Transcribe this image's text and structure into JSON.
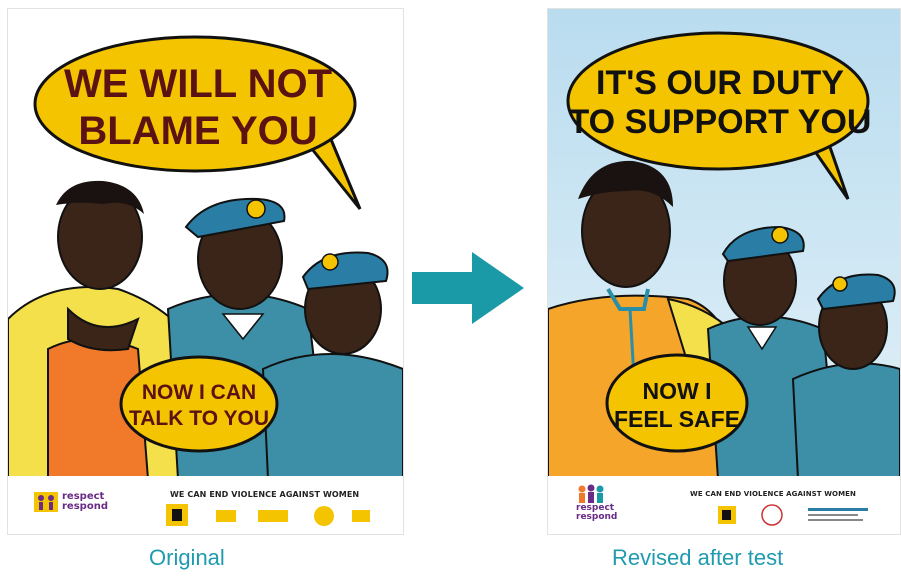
{
  "original": {
    "speech_bubble_lines": [
      "WE WILL NOT",
      "BLAME YOU"
    ],
    "reply_bubble_lines": [
      "NOW I CAN",
      "TALK TO YOU"
    ],
    "logo_text_lines": [
      "respect",
      "respond"
    ],
    "tagline": "WE CAN END VIOLENCE AGAINST WOMEN",
    "caption": "Original"
  },
  "revised": {
    "speech_bubble_lines": [
      "IT'S OUR DUTY",
      "TO SUPPORT YOU"
    ],
    "reply_bubble_lines": [
      "NOW I",
      "FEEL SAFE"
    ],
    "logo_text_lines": [
      "respect",
      "respond"
    ],
    "tagline": "WE CAN END VIOLENCE AGAINST WOMEN",
    "caption": "Revised after test"
  },
  "arrow_icon": "right-arrow-icon",
  "colors": {
    "bubble_yellow": "#f5c400",
    "uniform_blue": "#3d8fa8",
    "beret_blue": "#2a7ea6",
    "arrow_teal": "#1a99a6",
    "caption_teal": "#1f9bb0",
    "sky_blue": "#cfe6f3"
  }
}
